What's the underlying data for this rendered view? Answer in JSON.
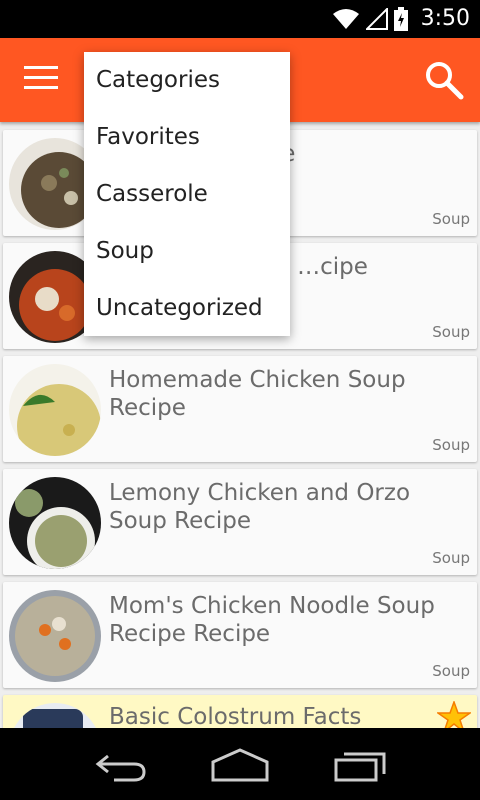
{
  "status_bar": {
    "time": "3:50"
  },
  "dropdown": {
    "items": [
      "Categories",
      "Favorites",
      "Casserole",
      "Soup",
      "Uncategorized"
    ]
  },
  "recipes": [
    {
      "title": "…o Soup Recipe",
      "category": "Soup",
      "favorite": false
    },
    {
      "title": "…t Chicken and …cipe",
      "category": "Soup",
      "favorite": false
    },
    {
      "title": "Homemade Chicken Soup Recipe",
      "category": "Soup",
      "favorite": false
    },
    {
      "title": "Lemony Chicken and Orzo Soup Recipe",
      "category": "Soup",
      "favorite": false
    },
    {
      "title": "Mom's Chicken Noodle Soup Recipe Recipe",
      "category": "Soup",
      "favorite": false
    },
    {
      "title": "Basic Colostrum Facts",
      "category": "",
      "favorite": true
    }
  ],
  "colors": {
    "accent": "#ff5722",
    "favorite_bg": "#fff9c4"
  },
  "icons": [
    "wifi-icon",
    "signal-icon",
    "battery-icon",
    "menu-icon",
    "search-icon",
    "star-icon",
    "back-icon",
    "home-icon",
    "recents-icon"
  ]
}
